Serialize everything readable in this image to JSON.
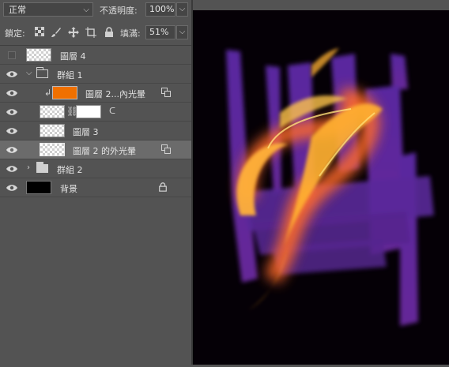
{
  "toolbar": {
    "blend_mode": "正常",
    "opacity_label": "不透明度:",
    "opacity_value": "100%",
    "lock_label": "鎖定:",
    "fill_label": "填滿:",
    "fill_value": "51%"
  },
  "layers": [
    {
      "name": "圖層 4",
      "visible": false
    },
    {
      "name": "群組 1",
      "visible": true,
      "type": "group",
      "expanded": true
    },
    {
      "name": "圖層 2...內光暈",
      "visible": true,
      "clipped": true
    },
    {
      "name": "",
      "visible": true,
      "has_mask": true
    },
    {
      "name": "圖層 3",
      "visible": true
    },
    {
      "name": "圖層 2 的外光暈",
      "visible": true,
      "selected": true
    },
    {
      "name": "群組 2",
      "visible": true,
      "type": "group",
      "expanded": false
    },
    {
      "name": "背景",
      "visible": true,
      "locked": true
    }
  ],
  "colors": {
    "panel_bg": "#535353",
    "selected_row": "#6b6b6b",
    "canvas_bg": "#050006",
    "stroke_purple": "#6a2ca8",
    "glow_orange": "#ffb030",
    "layer_thumb_orange": "#f07000"
  }
}
